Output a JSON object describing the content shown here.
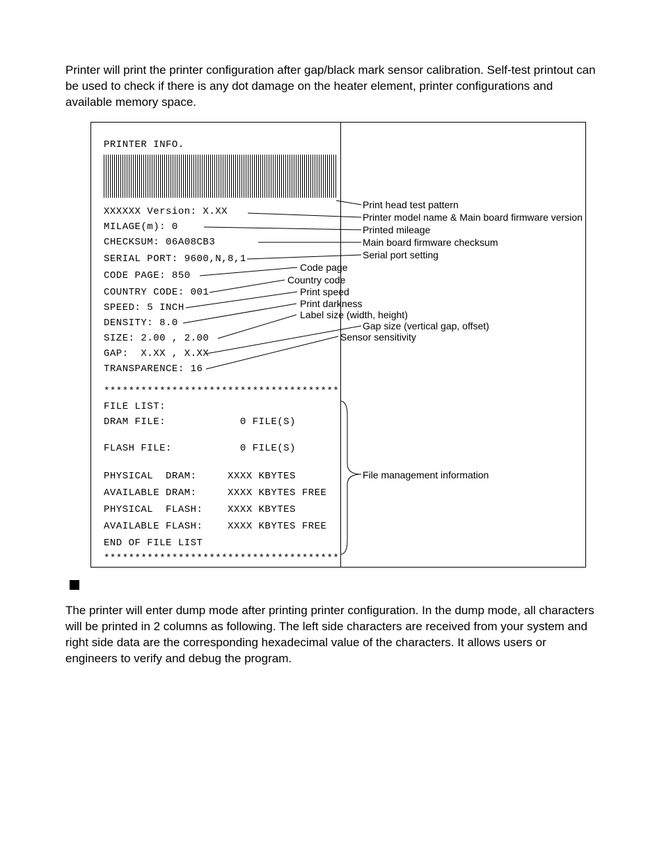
{
  "intro_paragraph": "Printer will print the printer configuration after gap/black mark sensor calibration. Self-test printout can be used to check if there is any dot damage on the heater element, printer configurations and available memory space.",
  "printout": {
    "title": "PRINTER INFO.",
    "version_line": "XXXXXX Version: X.XX",
    "mileage_line": "MILAGE(m): 0",
    "checksum_line": "CHECKSUM: 06A08CB3",
    "serial_port_line": "SERIAL PORT: 9600,N,8,1",
    "code_page_line": "CODE PAGE: 850",
    "country_code_line": "COUNTRY CODE: 001",
    "speed_line": "SPEED: 5 INCH",
    "density_line": "DENSITY: 8.0",
    "size_line": "SIZE: 2.00 , 2.00",
    "gap_line": "GAP:  X.XX , X.XX",
    "transparence_line": "TRANSPARENCE: 16",
    "separator": "**************************************",
    "file_list_header": "FILE LIST:",
    "dram_file_line": "DRAM FILE:            0 FILE(S)",
    "flash_file_line": "FLASH FILE:           0 FILE(S)",
    "physical_dram_line": "PHYSICAL  DRAM:     XXXX KBYTES",
    "available_dram_line": "AVAILABLE DRAM:     XXXX KBYTES FREE",
    "physical_flash_line": "PHYSICAL  FLASH:    XXXX KBYTES",
    "available_flash_line": "AVAILABLE FLASH:    XXXX KBYTES FREE",
    "end_line": "END OF FILE LIST"
  },
  "callouts": {
    "head_test": "Print head test pattern",
    "model_fw": "Printer model name & Main board firmware version",
    "mileage": "Printed mileage",
    "checksum": "Main board firmware checksum",
    "serial": "Serial port setting",
    "codepage": "Code page",
    "country": "Country code",
    "speed": "Print speed",
    "darkness": "Print darkness",
    "label_size": "Label size (width, height)",
    "gap_size": "Gap size (vertical gap, offset)",
    "sensitivity": "Sensor sensitivity",
    "file_mgmt": "File management information"
  },
  "dump_paragraph": "The printer will enter dump mode after printing printer configuration. In the dump mode, all characters will be printed in 2 columns as following. The left side characters are received from your system and right side data are the corresponding hexadecimal value of the characters. It allows users or engineers to verify and debug the program."
}
